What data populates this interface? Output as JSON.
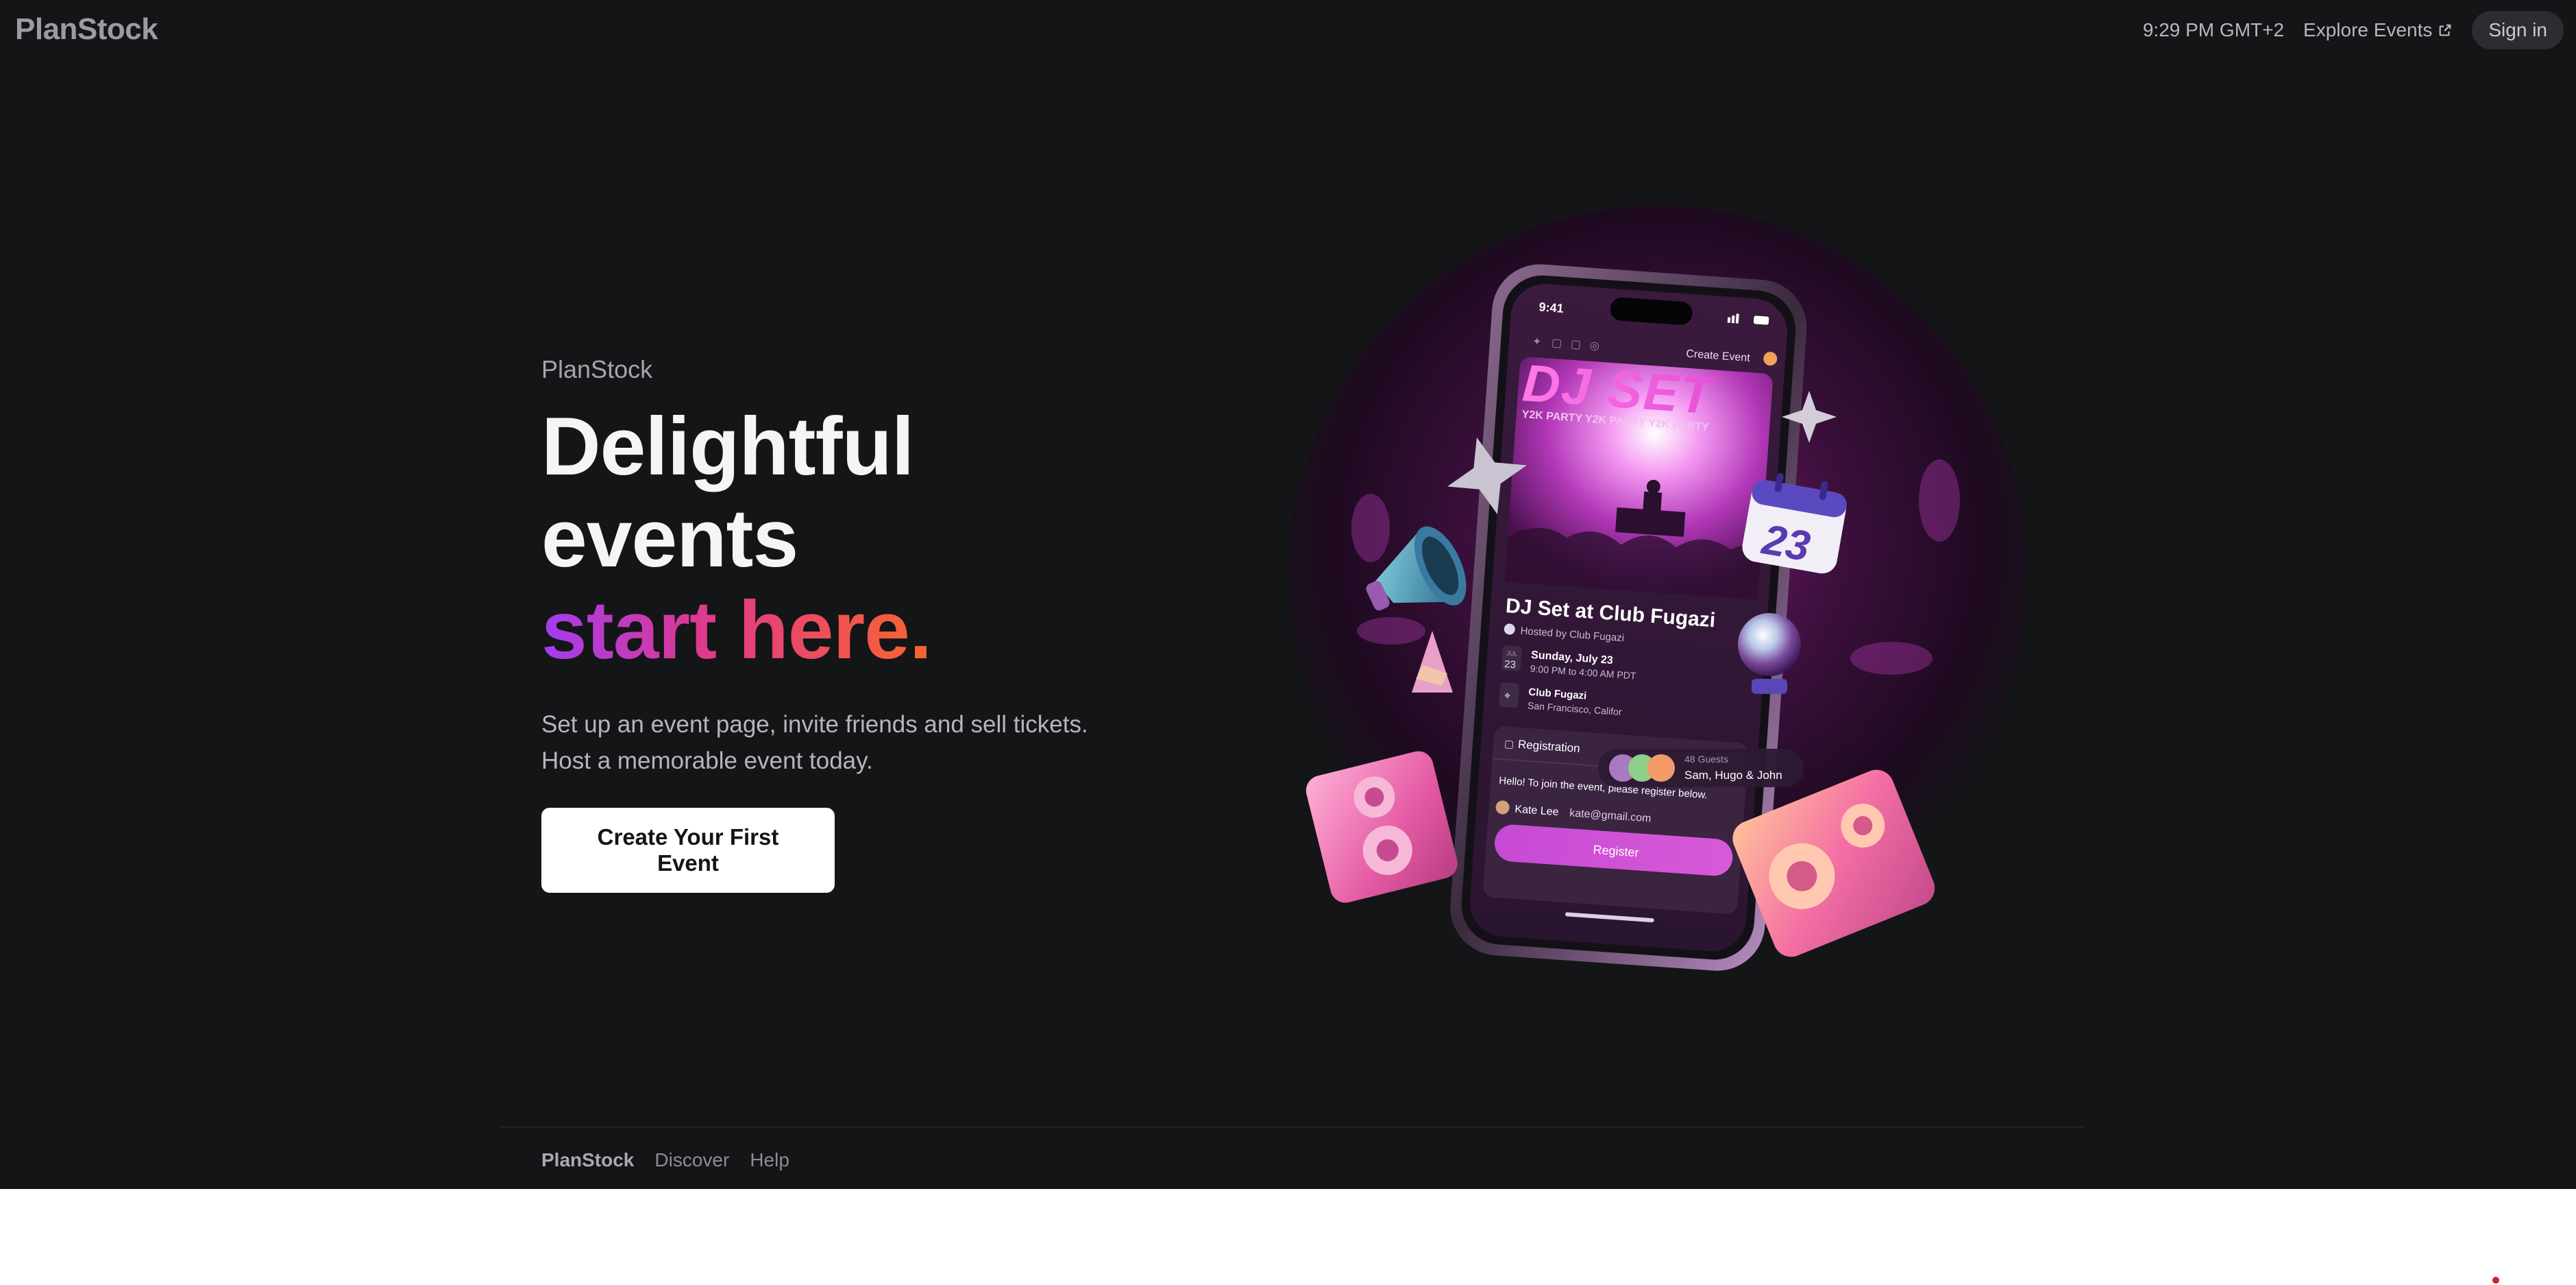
{
  "header": {
    "brand": "PlanStock",
    "time": "9:29 PM GMT+2",
    "explore_label": "Explore Events",
    "signin_label": "Sign in"
  },
  "hero": {
    "kicker": "PlanStock",
    "headline_line1": "Delightful",
    "headline_line2": "events",
    "headline_line3": "start here.",
    "subtext_line1": "Set up an event page, invite friends and sell tickets.",
    "subtext_line2": "Host a memorable event today.",
    "cta_label": "Create Your First Event"
  },
  "phone": {
    "status_time": "9:41",
    "nav_create": "Create Event",
    "banner_title": "DJ SET",
    "banner_sub": "Y2K PARTY Y2K PARTY Y2K PARTY",
    "event_title": "DJ Set at Club Fugazi",
    "host": "Hosted by Club Fugazi",
    "date_month": "JUL",
    "date_day": "23",
    "date_line": "Sunday, July 23",
    "time_line": "9:00 PM to 4:00 AM PDT",
    "venue": "Club Fugazi",
    "venue_city": "San Francisco, Califor",
    "guests_count": "48 Guests",
    "guests_names": "Sam, Hugo & John",
    "registration_label": "Registration",
    "registration_msg": "Hello! To join the event, please register below.",
    "user_name": "Kate Lee",
    "user_email": "kate@gmail.com",
    "register_label": "Register",
    "calendar_day": "23"
  },
  "footer": {
    "brand": "PlanStock",
    "discover": "Discover",
    "help": "Help"
  },
  "colors": {
    "background": "#141517",
    "accent_purple": "#a23cf0",
    "accent_pink": "#e33a86",
    "accent_orange": "#f7662c"
  }
}
